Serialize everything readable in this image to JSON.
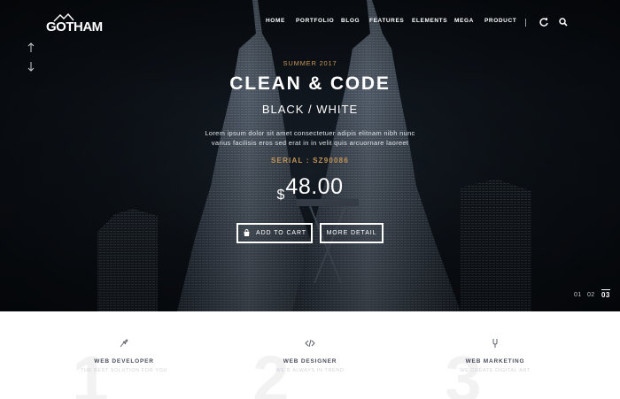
{
  "brand": {
    "logo_text": "GOTHAM"
  },
  "nav": {
    "items": [
      {
        "label": "HOME"
      },
      {
        "label": "PORTFOLIO"
      },
      {
        "label": "BLOG"
      },
      {
        "label": "FEATURES"
      },
      {
        "label": "ELEMENTS"
      },
      {
        "label": "MEGA"
      },
      {
        "label": "PRODUCT"
      }
    ],
    "icons": [
      "refresh-icon",
      "search-icon"
    ]
  },
  "slider_arrows": {
    "up": "↑",
    "down": "↓"
  },
  "hero": {
    "season": "SUMMER 2017",
    "title": "CLEAN & CODE",
    "subtitle": "BLACK / WHITE",
    "description": "Lorem ipsum dolor sit amet consectetuer adipis elitnam nibh nunc varius facilisis eros sed erat in in velit quis arcuornare laoreet",
    "serial": "SERIAL : SZ90086",
    "price_currency": "$",
    "price_amount": "48.00",
    "add_to_cart": "ADD TO CART",
    "more_detail": "MORE DETAIL"
  },
  "pager": {
    "pages": [
      "01",
      "02",
      "03"
    ],
    "active": "03"
  },
  "services": [
    {
      "number": "1",
      "icon": "pen-icon",
      "title": "WEB DEVELOPER",
      "tagline": "THE BEST SOLUTION FOR YOU"
    },
    {
      "number": "2",
      "icon": "code-icon",
      "title": "WEB DESIGNER",
      "tagline": "WE R ALWAYS IN TREND"
    },
    {
      "number": "3",
      "icon": "fork-icon",
      "title": "WEB MARKETING",
      "tagline": "WE CREATE DIGITAL ART"
    }
  ],
  "colors": {
    "accent": "#c49558",
    "hero_bg": "#0f151c",
    "text_dark": "#4a4e5a"
  }
}
